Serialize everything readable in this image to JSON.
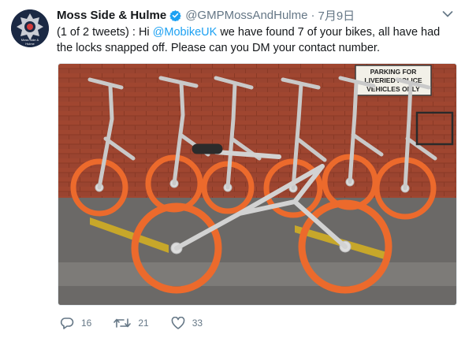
{
  "tweet": {
    "display_name": "Moss Side & Hulme",
    "handle": "@GMPMossAndHulme",
    "separator": "·",
    "date": "7月9日",
    "text_before": "(1 of 2 tweets) :  Hi ",
    "mention": "@MobikeUK",
    "text_after": " we have found 7 of your bikes, all have had the locks snapped off.  Please can you DM your contact number.",
    "image_sign": [
      "PARKING FOR",
      "LIVERIED POLICE",
      "VEHICLES ONLY"
    ],
    "avatar_text": [
      "Moss Side &",
      "Hulme"
    ]
  },
  "actions": {
    "replies": "16",
    "retweets": "21",
    "likes": "33"
  },
  "colors": {
    "link": "#1da1f2",
    "muted": "#657786",
    "verified": "#1da1f2",
    "bike_orange": "#ec6a2c"
  },
  "icons": {
    "verified": "verified-badge-icon",
    "caret": "chevron-down-icon",
    "reply": "reply-icon",
    "retweet": "retweet-icon",
    "like": "heart-icon"
  }
}
